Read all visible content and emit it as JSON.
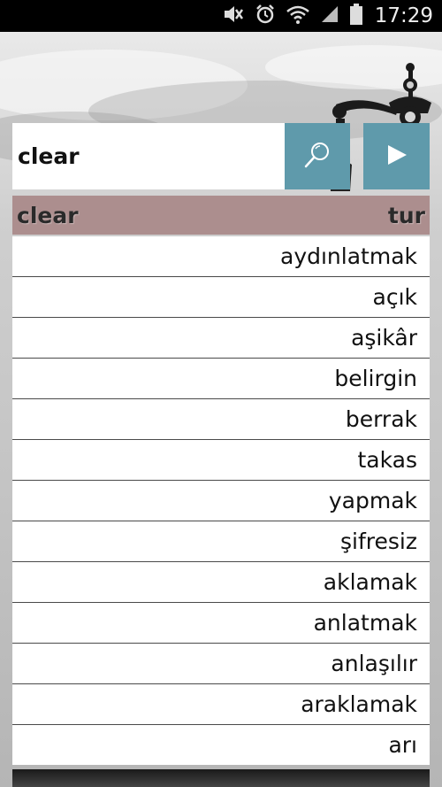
{
  "status_bar": {
    "time": "17:29",
    "icons": [
      "mute-icon",
      "alarm-icon",
      "wifi-icon",
      "signal-icon",
      "battery-icon"
    ]
  },
  "search": {
    "value": "clear",
    "search_icon": "search-icon",
    "play_icon": "play-icon"
  },
  "colors": {
    "accent": "#5f9aab",
    "header": "#ac8e8e"
  },
  "results": {
    "source_word": "clear",
    "target_language": "tur",
    "items": [
      "aydınlatmak",
      "açık",
      "aşikâr",
      "belirgin",
      "berrak",
      "takas",
      "yapmak",
      "şifresiz",
      "aklamak",
      "anlatmak",
      "anlaşılır",
      "araklamak",
      "arı"
    ]
  }
}
